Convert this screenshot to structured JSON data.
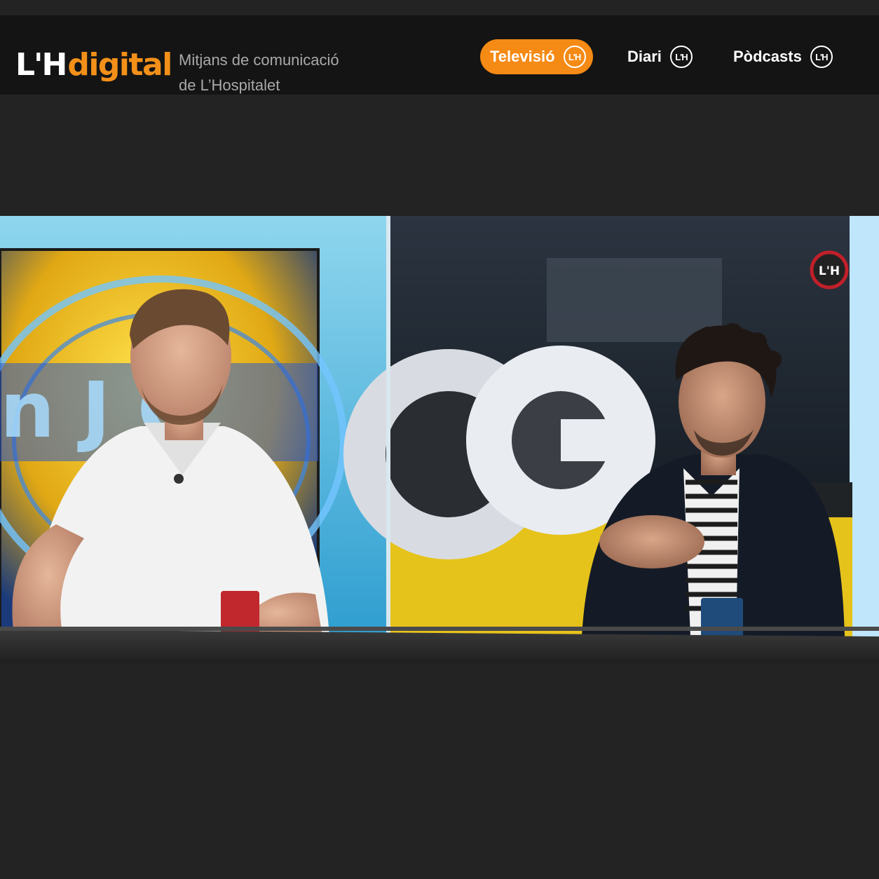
{
  "header": {
    "logo": {
      "mark": "L'H",
      "word": "digital"
    },
    "tagline": {
      "line1": "Mitjans de comunicació",
      "line2": "de L’Hospitalet"
    },
    "nav": [
      {
        "label": "Televisió",
        "badge": "L'H",
        "active": true
      },
      {
        "label": "Diari",
        "badge": "L'H",
        "active": false
      },
      {
        "label": "Pòdcasts",
        "badge": "L'H",
        "active": false
      }
    ]
  },
  "video": {
    "watermark": "L'H"
  },
  "colors": {
    "accent": "#f58a14",
    "header_bg": "#141414",
    "page_bg": "#232323",
    "tagline": "#a9a9a9"
  }
}
